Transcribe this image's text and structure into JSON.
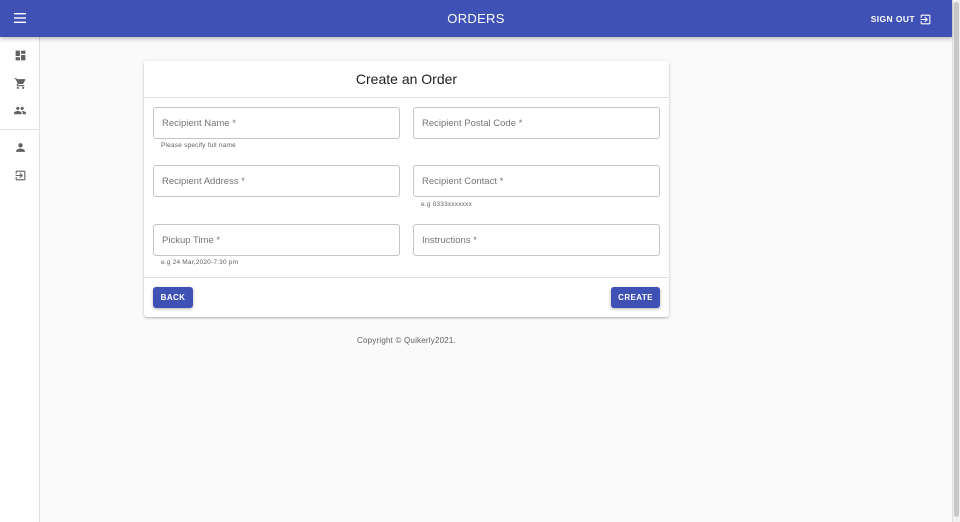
{
  "appbar": {
    "title": "ORDERS",
    "menu_icon": "menu-icon",
    "signout_label": "SIGN OUT",
    "signout_icon": "exit-icon",
    "color": "#3f51b5"
  },
  "drawer": {
    "items": [
      {
        "icon": "dashboard-icon"
      },
      {
        "icon": "cart-icon"
      },
      {
        "icon": "people-icon"
      },
      {
        "icon": "person-icon"
      },
      {
        "icon": "exit-icon"
      }
    ]
  },
  "form": {
    "title": "Create an Order",
    "fields": {
      "recipient_name": {
        "placeholder": "Recipient Name *",
        "value": "",
        "helper": "Please specify full name"
      },
      "recipient_postal_code": {
        "placeholder": "Recipient Postal Code *",
        "value": ""
      },
      "recipient_address": {
        "placeholder": "Recipient Address *",
        "value": ""
      },
      "recipient_contact": {
        "placeholder": "Recipient Contact *",
        "value": "",
        "helper": "e.g 0333xxxxxxx"
      },
      "pickup_time": {
        "placeholder": "Pickup Time *",
        "value": "",
        "helper": "e.g 24 Mar,2020-7:30 pm"
      },
      "instructions": {
        "placeholder": "Instructions *",
        "value": ""
      }
    },
    "back_label": "BACK",
    "create_label": "CREATE"
  },
  "footer": {
    "text": "Copyright © Quikerly2021."
  }
}
